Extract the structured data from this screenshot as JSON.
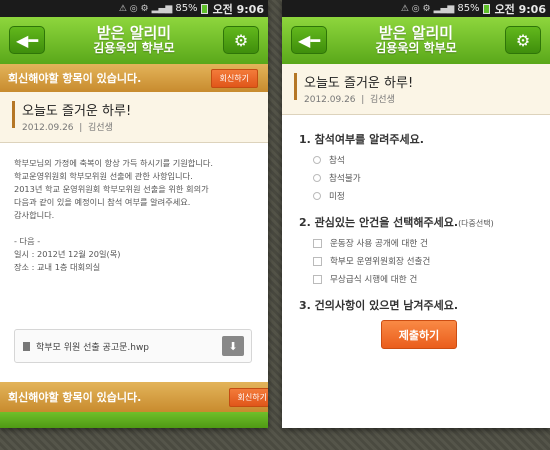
{
  "status": {
    "time": "오전 9:06",
    "battery": "85%"
  },
  "header": {
    "title": "받은 알리미",
    "subtitle": "김용욱의 학부모"
  },
  "icons": {
    "back": "back-arrow-icon",
    "settings": "gear-icon",
    "download": "download-icon",
    "file": "file-icon"
  },
  "colors": {
    "green": "#6cbf22",
    "orange": "#ec6424",
    "notice": "#d49a3f"
  },
  "notice": {
    "text": "회신해야할 항목이 있습니다.",
    "reply_label": "회신하기"
  },
  "message": {
    "title": "오늘도 즐거운 하루!",
    "date": "2012.09.26",
    "author": "김선생",
    "body": [
      "학부모님의 가정에 축복이 항상 가득 하시기를 기원합니다.",
      "학교운영위원회 학부모위원 선출에 관한 사항입니다.",
      "2013년 학교 운영위원회 학부모위원 선출을 위한 회의가",
      "다음과 같이 있을 예정이니 참석 여부를 알려주세요.",
      "감사합니다."
    ],
    "details": [
      "- 다음 -",
      "일시 : 2012년 12월 20일(목)",
      "장소 : 교내 1층 대회의실"
    ],
    "attachment": "학부모 위원 선출 공고문.hwp"
  },
  "form": {
    "q1": "1. 참석여부를 알려주세요.",
    "q1_options": [
      "참석",
      "참석불가",
      "미정"
    ],
    "q2": "2. 관심있는 안건을 선택해주세요.",
    "q2_note": "(다중선택)",
    "q2_options": [
      "운동장 사용 공개에 대한 건",
      "학부모 운영위원회장 선출건",
      "무상급식 시행에 대한 건"
    ],
    "q3": "3. 건의사항이 있으면 남겨주세요.",
    "submit_label": "제출하기"
  }
}
